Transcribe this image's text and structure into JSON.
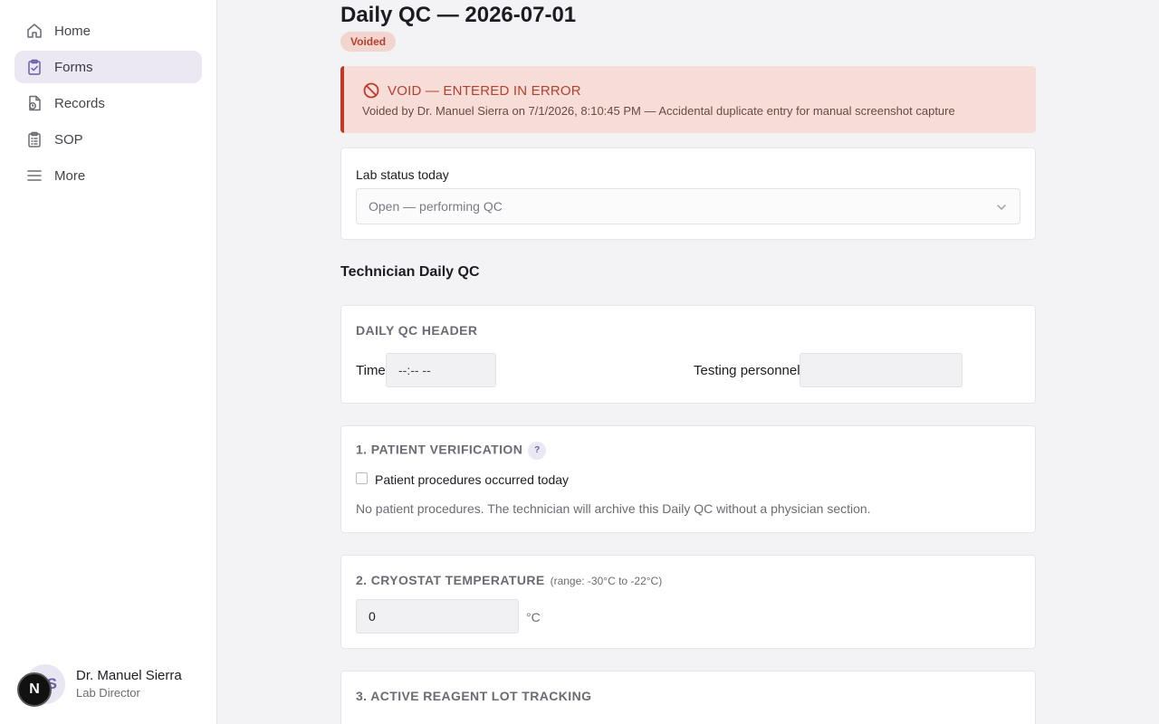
{
  "sidebar": {
    "items": [
      {
        "label": "Home",
        "icon": "home-icon"
      },
      {
        "label": "Forms",
        "icon": "clipboard-check-icon",
        "active": true
      },
      {
        "label": "Records",
        "icon": "records-icon"
      },
      {
        "label": "SOP",
        "icon": "clipboard-list-icon"
      },
      {
        "label": "More",
        "icon": "menu-icon"
      }
    ],
    "user": {
      "initials": "S",
      "name": "Dr. Manuel Sierra",
      "role": "Lab Director",
      "badge": "N"
    }
  },
  "header": {
    "title": "Daily QC — 2026-07-01",
    "status": "Voided"
  },
  "void_banner": {
    "title": "VOID — ENTERED IN ERROR",
    "description": "Voided by Dr. Manuel Sierra on 7/1/2026, 8:10:45 PM — Accidental duplicate entry for manual screenshot capture"
  },
  "lab_status": {
    "label": "Lab status today",
    "value": "Open — performing QC"
  },
  "section_title": "Technician Daily QC",
  "qc_header": {
    "title": "DAILY QC HEADER",
    "time_label": "Time",
    "time_placeholder": "--:-- --",
    "personnel_label": "Testing personnel",
    "personnel_value": ""
  },
  "patient_verification": {
    "title": "1. PATIENT VERIFICATION",
    "help": "?",
    "checkbox_label": "Patient procedures occurred today",
    "checked": false,
    "note": "No patient procedures. The technician will archive this Daily QC without a physician section."
  },
  "cryostat": {
    "title": "2. CRYOSTAT TEMPERATURE",
    "range": "(range: -30°C to -22°C)",
    "value": "0",
    "unit": "°C"
  },
  "reagent": {
    "title": "3. ACTIVE REAGENT LOT TRACKING"
  },
  "colors": {
    "accent": "#6b5fa5",
    "void_red": "#c0392b",
    "void_bg": "#f6ddd7",
    "active_nav": "#ebe8f4"
  }
}
